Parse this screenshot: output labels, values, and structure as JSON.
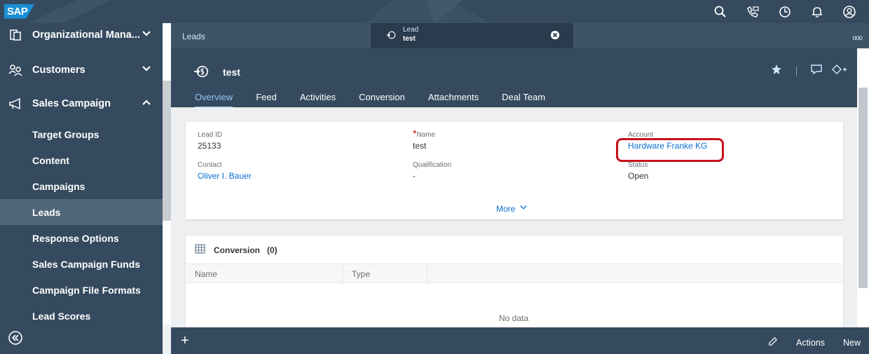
{
  "shell": {
    "logo": "SAP",
    "icons": [
      "search-icon",
      "chat-icon",
      "clock-icon",
      "bell-icon",
      "user-icon"
    ]
  },
  "sidebar": {
    "items": [
      {
        "label": "Organizational Mana...",
        "icon": "org-icon",
        "expanded": false
      },
      {
        "label": "Customers",
        "icon": "customers-icon",
        "expanded": false
      },
      {
        "label": "Sales Campaign",
        "icon": "megaphone-icon",
        "expanded": true
      }
    ],
    "subitems": [
      {
        "label": "Target Groups"
      },
      {
        "label": "Content"
      },
      {
        "label": "Campaigns"
      },
      {
        "label": "Leads",
        "active": true
      },
      {
        "label": "Response Options"
      },
      {
        "label": "Sales Campaign Funds"
      },
      {
        "label": "Campaign File Formats"
      },
      {
        "label": "Lead Scores"
      }
    ]
  },
  "tabbar": {
    "tab1": "Leads",
    "tab2_type": "Lead",
    "tab2_name": "test",
    "more": "ooo"
  },
  "object": {
    "title": "test",
    "tabs": [
      "Overview",
      "Feed",
      "Activities",
      "Conversion",
      "Attachments",
      "Deal Team"
    ],
    "selected_tab": "Overview"
  },
  "fields": {
    "lead_id_label": "Lead ID",
    "lead_id": "25133",
    "name_label": "Name",
    "name": "test",
    "account_label": "Account",
    "account": "Hardware Franke KG",
    "contact_label": "Contact",
    "contact": "Oliver I. Bauer",
    "qualification_label": "Qualification",
    "qualification": "-",
    "status_label": "Status",
    "status": "Open",
    "more": "More"
  },
  "conversion": {
    "title": "Conversion",
    "count": "(0)",
    "col_name": "Name",
    "col_type": "Type",
    "empty": "No data"
  },
  "footer": {
    "plus": "+",
    "actions": "Actions",
    "new": "New"
  },
  "colors": {
    "shell": "#354a5f",
    "link": "#0a6ed1",
    "highlight": "#c8101c"
  }
}
